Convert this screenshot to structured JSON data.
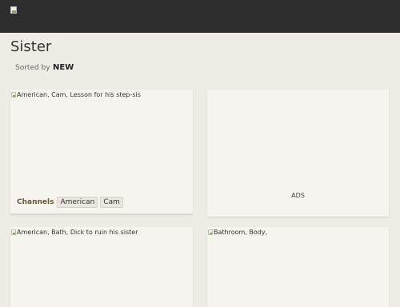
{
  "header": {
    "logo_icon": "broken-image-icon"
  },
  "page": {
    "title": "Sister"
  },
  "sort": {
    "label": "Sorted by",
    "value": "NEW"
  },
  "videos": [
    {
      "alt": "American, Cam, Lesson for his step-sis",
      "channels_label": "Channels",
      "tags": [
        "American",
        "Cam"
      ]
    },
    {
      "alt": "American, Bath, Dick to ruin his sister"
    },
    {
      "alt": "Bathroom, Body,"
    }
  ],
  "ad": {
    "label": "ADS"
  },
  "colors": {
    "header_bg": "#2d2d2d",
    "page_bg": "#efece6",
    "card_bg": "#f6f4ef",
    "channels_label": "#6a5a3d"
  }
}
